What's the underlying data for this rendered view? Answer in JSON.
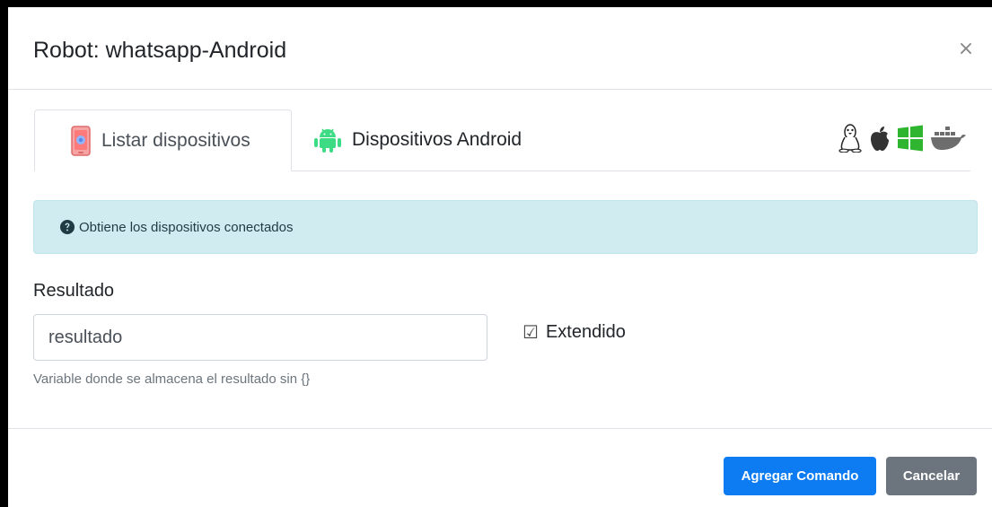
{
  "modal": {
    "title": "Robot: whatsapp-Android",
    "close_label": "×"
  },
  "tabs": [
    {
      "label": "Listar dispositivos",
      "icon": "phone-icon",
      "active": true
    },
    {
      "label": "Dispositivos Android",
      "icon": "android-icon",
      "active": false
    }
  ],
  "platform_icons": [
    "linux-icon",
    "apple-icon",
    "windows-icon",
    "docker-icon"
  ],
  "info": {
    "icon": "question-circle-icon",
    "text": "Obtiene los dispositivos conectados"
  },
  "form": {
    "result_label": "Resultado",
    "result_value": "resultado",
    "extended_label": "Extendido",
    "extended_checked": true,
    "help_text": "Variable donde se almacena el resultado sin {}"
  },
  "footer": {
    "add_label": "Agregar Comando",
    "cancel_label": "Cancelar"
  },
  "colors": {
    "primary": "#0d7cf2",
    "secondary": "#6c757d",
    "info_bg": "#d1ecf1",
    "android_green": "#3ddc84",
    "windows_green": "#2fb52f",
    "docker_gray": "#6d6d6d"
  }
}
